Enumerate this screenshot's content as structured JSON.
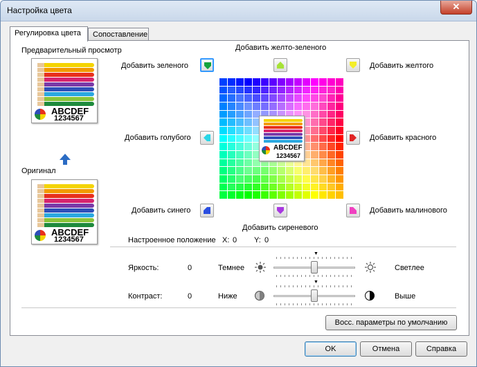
{
  "window": {
    "title": "Настройка цвета",
    "close_glyph": "✕"
  },
  "tabs": [
    {
      "label": "Регулировка цвета",
      "active": true
    },
    {
      "label": "Сопоставление",
      "active": false
    }
  ],
  "preview": {
    "label": "Предварительный просмотр",
    "original_label": "Оригинал",
    "thumb_text_1": "ABCDEF",
    "thumb_text_2": "1234567"
  },
  "color_buttons": {
    "yellow_green": "Добавить желто-зеленого",
    "green": "Добавить зеленого",
    "yellow": "Добавить желтого",
    "cyan": "Добавить голубого",
    "red": "Добавить красного",
    "blue": "Добавить синего",
    "purple": "Добавить сиреневого",
    "magenta": "Добавить малинового"
  },
  "position": {
    "label": "Настроенное положение",
    "x_label": "X:",
    "x_value": "0",
    "y_label": "Y:",
    "y_value": "0"
  },
  "brightness": {
    "label": "Яркость:",
    "value": "0",
    "low_label": "Темнее",
    "high_label": "Светлее",
    "level": 0.5
  },
  "contrast": {
    "label": "Контраст:",
    "value": "0",
    "low_label": "Ниже",
    "high_label": "Выше",
    "level": 0.5
  },
  "buttons": {
    "restore_defaults": "Восс. параметры по умолчанию",
    "ok": "OK",
    "cancel": "Отмена",
    "help": "Справка"
  },
  "colors": {
    "accent": "#3399ff",
    "panel_border": "#898c95"
  }
}
